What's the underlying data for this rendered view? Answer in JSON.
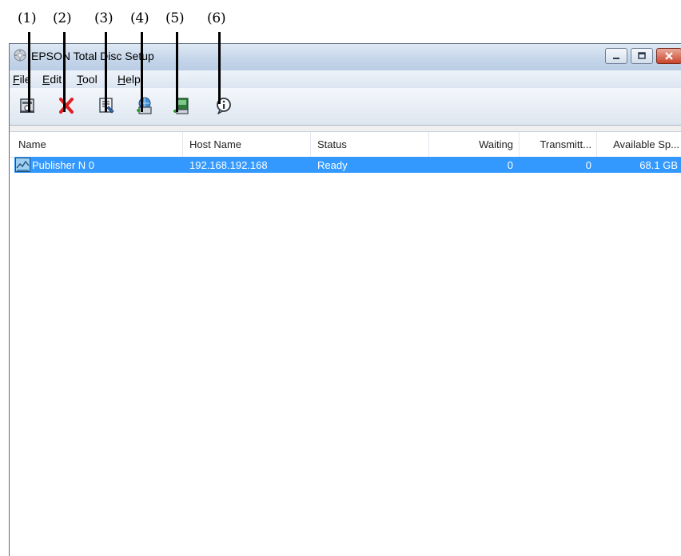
{
  "callouts": [
    "(1)",
    "(2)",
    "(3)",
    "(4)",
    "(5)",
    "(6)"
  ],
  "window": {
    "title": "EPSON Total Disc Setup",
    "menu": [
      {
        "accel": "F",
        "rest": "ile"
      },
      {
        "accel": "E",
        "rest": "dit"
      },
      {
        "accel": "T",
        "rest": "ool"
      },
      {
        "accel": "H",
        "rest": "elp"
      }
    ]
  },
  "toolbar": {
    "icons": [
      "publisher-properties-icon",
      "delete-icon",
      "edit-settings-icon",
      "add-network-publisher-icon",
      "add-local-publisher-icon",
      "info-icon"
    ]
  },
  "list": {
    "columns": [
      "Name",
      "Host Name",
      "Status",
      "Waiting",
      "Transmitt...",
      "Available Sp..."
    ],
    "rows": [
      {
        "name": "Publisher N 0",
        "host": "192.168.192.168",
        "status": "Ready",
        "waiting": "0",
        "transmitting": "0",
        "available": "68.1 GB",
        "selected": true
      }
    ]
  },
  "colors": {
    "selection": "#3399ff",
    "delete": "#e02020"
  }
}
